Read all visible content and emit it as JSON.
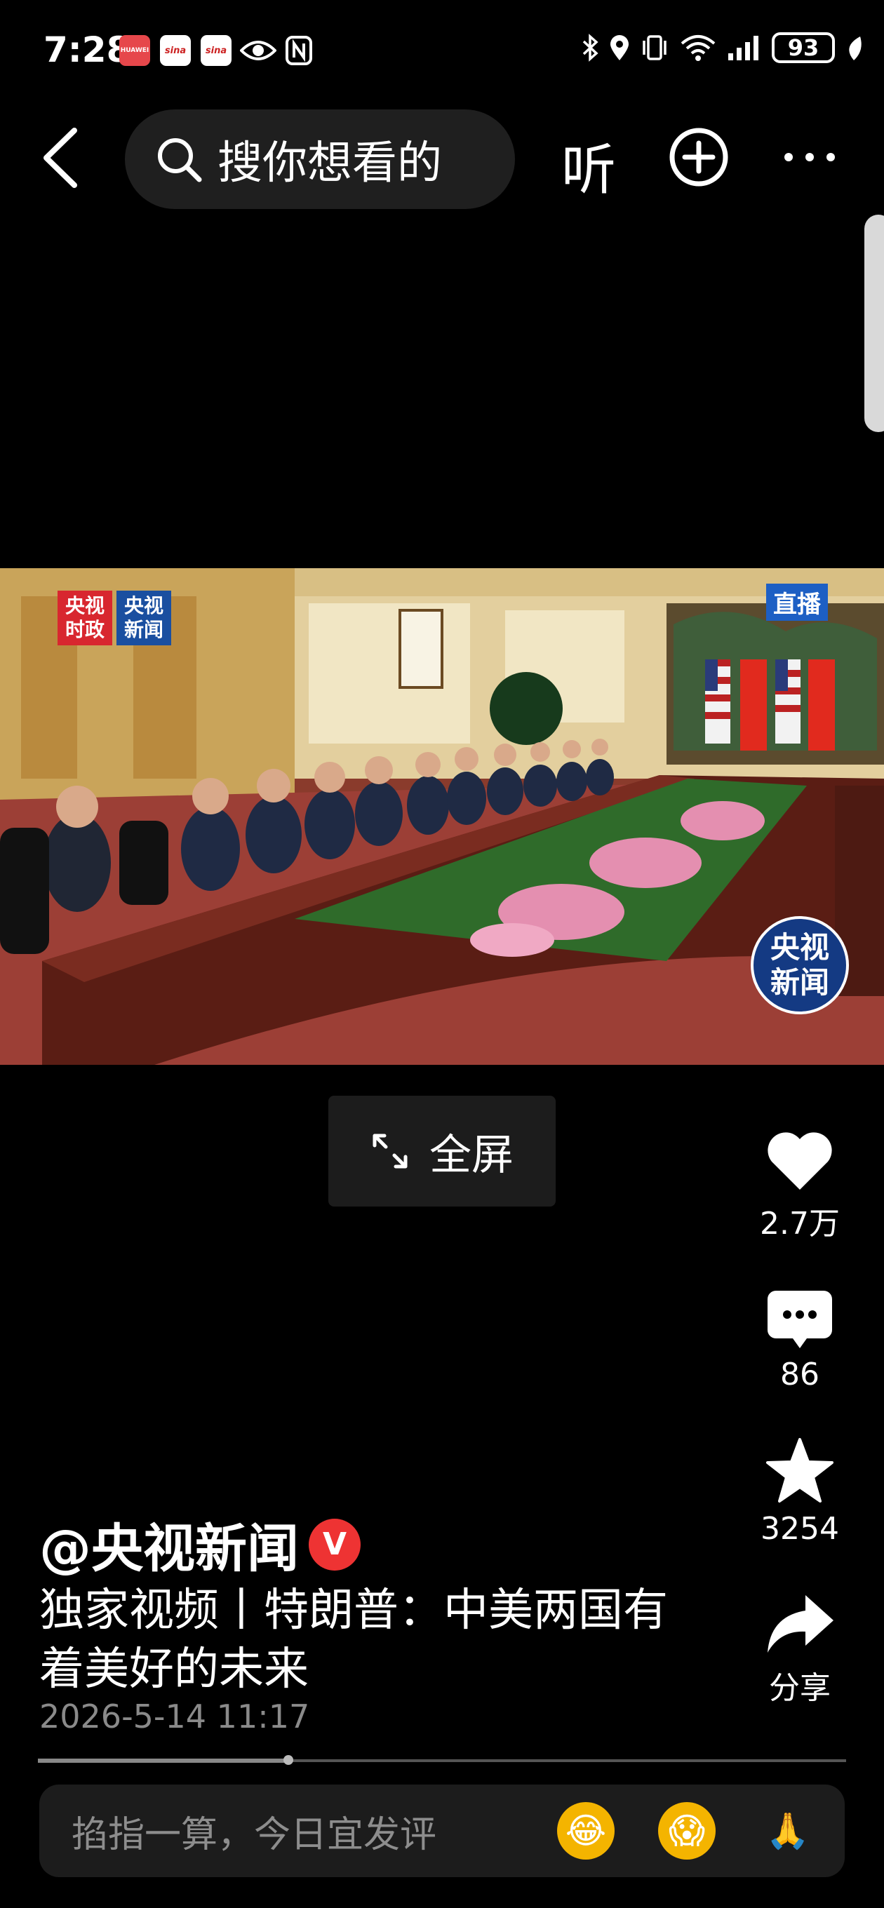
{
  "status_bar": {
    "time": "7:28",
    "battery": "93",
    "notifications": [
      "HUAWEI",
      "sina",
      "sina"
    ],
    "icons": [
      "eye-icon",
      "nfc-icon",
      "bluetooth-icon",
      "location-icon",
      "vibrate-icon",
      "wifi-icon",
      "signal-icon",
      "battery-icon",
      "leaf-icon"
    ]
  },
  "nav": {
    "search_placeholder": "搜你想看的",
    "listen_label": "听"
  },
  "video": {
    "logo_left": [
      "央视",
      "时政"
    ],
    "logo_right": [
      "央视",
      "新闻"
    ],
    "live_badge": "直播",
    "watermark": [
      "央视",
      "新闻"
    ]
  },
  "fullscreen_label": "全屏",
  "actions": {
    "likes": "2.7万",
    "comments": "86",
    "favorites": "3254",
    "share_label": "分享"
  },
  "post": {
    "author": "@央视新闻",
    "verified_mark": "V",
    "caption": "独家视频丨特朗普：中美两国有着美好的未来",
    "date": "2026-5-14 11:17"
  },
  "progress": 0.31,
  "comment_bar": {
    "placeholder": "掐指一算，今日宜发评",
    "emojis": [
      "😂",
      "😱",
      "🙏"
    ]
  },
  "colors": {
    "background": "#000000",
    "search_bg": "#1f1f1f",
    "verified": "#e33333",
    "live_badge": "#1d5fc4"
  }
}
